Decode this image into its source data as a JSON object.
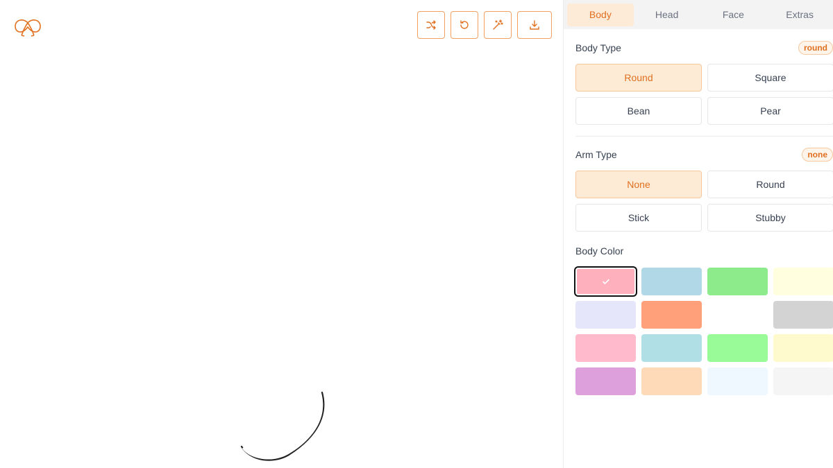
{
  "tabs": [
    {
      "label": "Body",
      "active": true
    },
    {
      "label": "Head",
      "active": false
    },
    {
      "label": "Face",
      "active": false
    },
    {
      "label": "Extras",
      "active": false
    }
  ],
  "toolbar": {
    "icons": [
      "shuffle-icon",
      "undo-icon",
      "magic-wand-icon",
      "download-icon"
    ],
    "accent": "#e07020"
  },
  "body_type": {
    "title": "Body Type",
    "badge": "round",
    "options": [
      "Round",
      "Square",
      "Bean",
      "Pear"
    ],
    "selected": "Round"
  },
  "arm_type": {
    "title": "Arm Type",
    "badge": "none",
    "options": [
      "None",
      "Round",
      "Stick",
      "Stubby"
    ],
    "selected": "None"
  },
  "body_color": {
    "title": "Body Color",
    "colors": [
      "#ffb0bd",
      "#b0d8e6",
      "#8eeb8c",
      "#ffffe0",
      "#e6e6fa",
      "#ffa07a",
      "#ffffff",
      "#d3d3d3",
      "#ffbbcc",
      "#b0e0e6",
      "#98fb98",
      "#fffacd",
      "#dda0dd",
      "#ffdab9",
      "#f0f8ff",
      "#f5f5f5"
    ],
    "selected_index": 0
  }
}
